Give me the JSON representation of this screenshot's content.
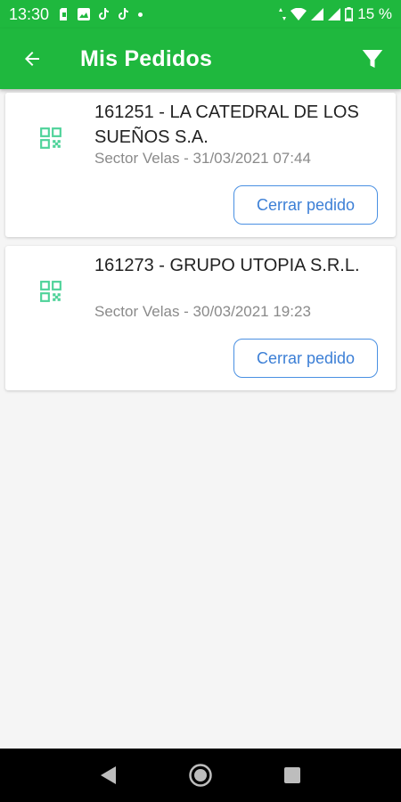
{
  "status_bar": {
    "time": "13:30",
    "battery": "15 %"
  },
  "app_bar": {
    "title": "Mis Pedidos",
    "back_icon": "arrow-back-icon",
    "filter_icon": "filter-icon"
  },
  "orders": [
    {
      "title": "161251 - LA CATEDRAL DE LOS SUEÑOS S.A.",
      "subtitle": "Sector Velas - 31/03/2021 07:44",
      "button_label": "Cerrar pedido"
    },
    {
      "title": "161273 - GRUPO UTOPIA S.R.L.",
      "subtitle": "Sector Velas - 30/03/2021 19:23",
      "button_label": "Cerrar pedido"
    }
  ],
  "colors": {
    "primary": "#1fb83e",
    "qr_icon": "#4fd39a",
    "button_border": "#4a90e2",
    "button_text": "#3c7fd6"
  }
}
